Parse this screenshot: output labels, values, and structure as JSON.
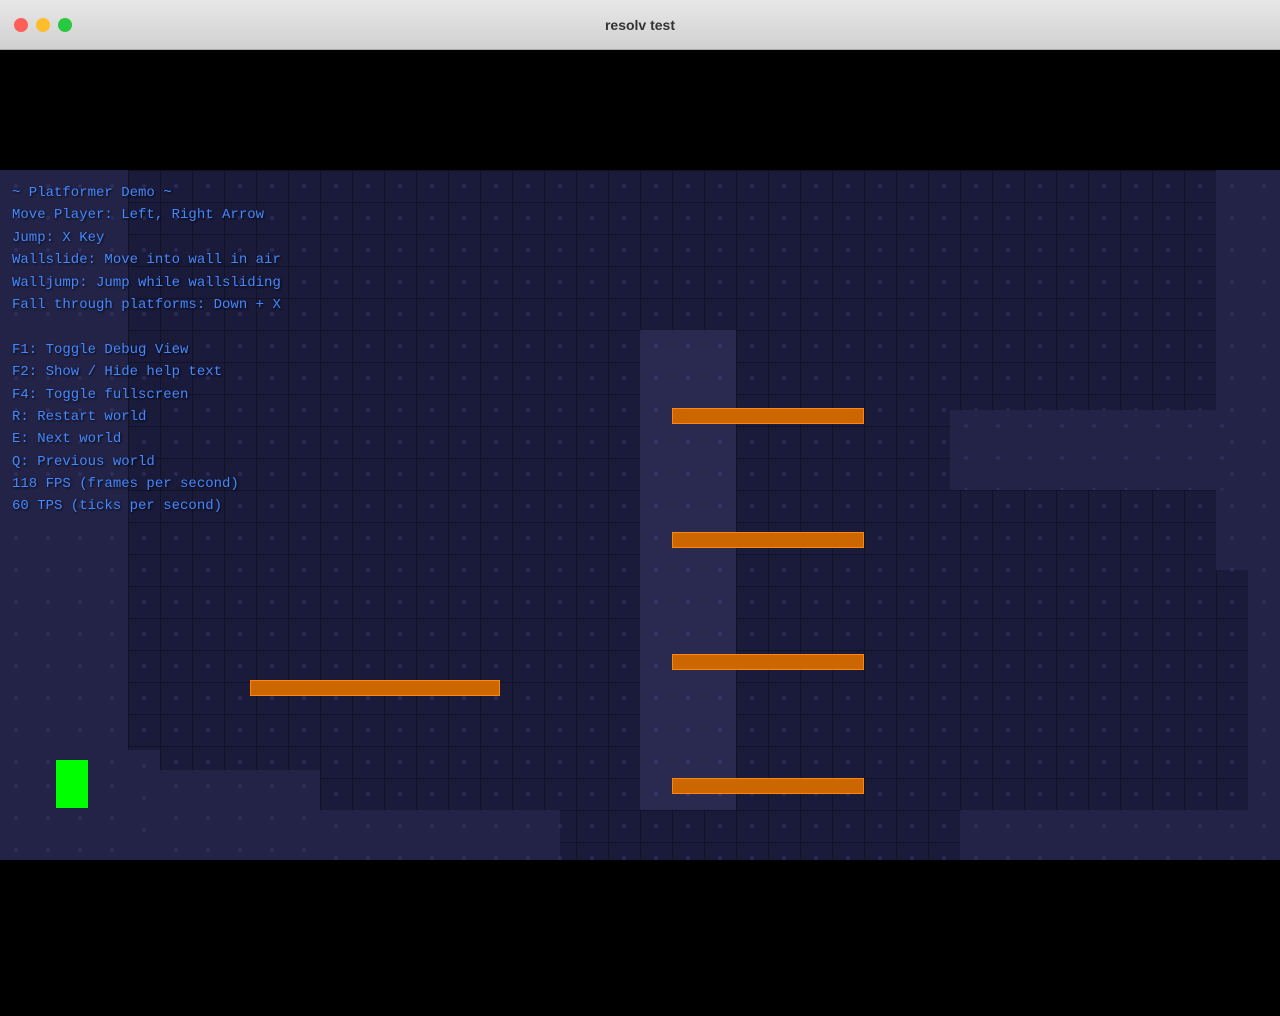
{
  "titlebar": {
    "title": "resolv test",
    "controls": {
      "close": "close",
      "minimize": "minimize",
      "maximize": "maximize"
    }
  },
  "hud": {
    "lines": [
      "~ Platformer Demo ~",
      "Move Player: Left, Right Arrow",
      "Jump: X Key",
      "Wallslide: Move into wall in air",
      "Walljump: Jump while wallsliding",
      "Fall through platforms: Down + X",
      "",
      "F1: Toggle Debug View",
      "F2: Show / Hide help text",
      "F4: Toggle fullscreen",
      "R: Restart world",
      "E: Next world",
      "Q: Previous world",
      "118 FPS (frames per second)",
      "60 TPS (ticks per second)"
    ]
  },
  "colors": {
    "hud_text": "#4488ff",
    "orange_platform": "#cc6600",
    "player": "#00ff00",
    "triangle_outline": "#ff00aa",
    "bg_tile": "#1a1a3a",
    "wall_tile": "#2d3060"
  }
}
